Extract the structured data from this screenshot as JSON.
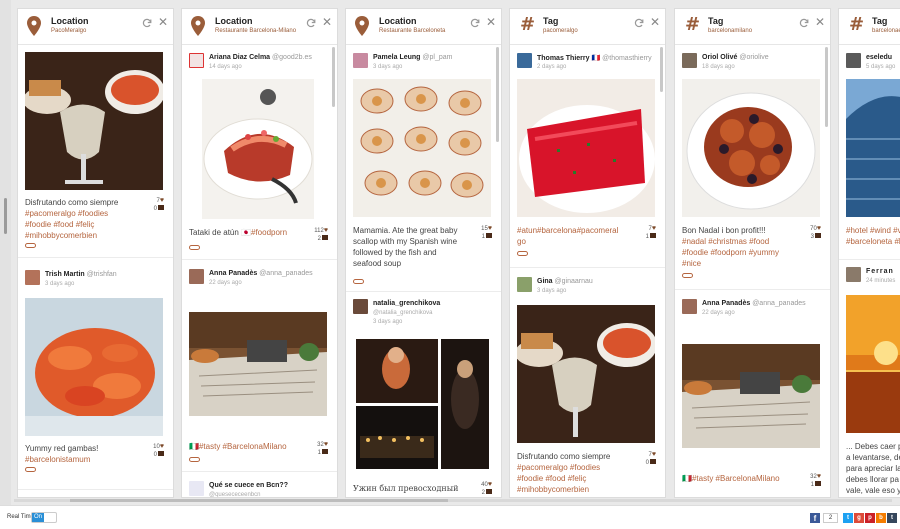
{
  "colors": {
    "accent": "#9a5d3a",
    "tag": "#b5653f",
    "toggle_on": "#2a8fd6"
  },
  "columns": [
    {
      "type_icon": "location-pin-icon",
      "title": "Location",
      "subtitle": "PacoMeralgo",
      "cards": [
        {
          "caption_text": "Disfrutando como siempre",
          "tags": [
            "#pacomeralgo #foodies",
            "#foodie #food #feliç",
            "#mihobbycomerbien"
          ],
          "likes": "7",
          "comments": "0"
        },
        {
          "user": "Trish Martin",
          "handle": "@trishfan",
          "time": "3 days ago",
          "caption_text": "Yummy red gambas!",
          "tags": [
            "#barcelonistamum"
          ],
          "likes": "10",
          "comments": "0"
        }
      ]
    },
    {
      "type_icon": "location-pin-icon",
      "title": "Location",
      "subtitle": "Restaurante Barcelona-Milano",
      "cards": [
        {
          "user": "Ariana Diaz Celma",
          "handle": "@good2b.es",
          "time": "14 days ago",
          "caption_text": "Tataki de atún 🇯🇵",
          "tags": [
            "#foodporn"
          ],
          "likes": "112",
          "comments": "2"
        },
        {
          "user": "Anna Panadès",
          "handle": "@anna_panades",
          "time": "22 days ago",
          "caption_text": "🇮🇹",
          "tags": [
            "#tasty #BarcelonaMilano"
          ],
          "likes": "32",
          "comments": "1"
        },
        {
          "user": "Qué se cuece en Bcn??",
          "handle": "@quesececeenbcn",
          "time": ""
        }
      ]
    },
    {
      "type_icon": "location-pin-icon",
      "title": "Location",
      "subtitle": "Restaurante Barceloneta",
      "cards": [
        {
          "user": "Pamela Leung",
          "handle": "@pl_pam",
          "time": "3 days ago",
          "caption_text": "Mamamia. Ate the great baby scallop with my Spanish wine followed by the fish and seafood soup",
          "tags": [],
          "likes": "15",
          "comments": "1"
        },
        {
          "user": "natalia_grenchikova",
          "handle": "@natalia_grenchikova",
          "time": "3 days ago",
          "caption_text": "Ужин был превосходный",
          "tags": [],
          "likes": "40",
          "comments": "2"
        }
      ]
    },
    {
      "type_icon": "hashtag-icon",
      "title": "Tag",
      "subtitle": "pacomeralgo",
      "cards": [
        {
          "user": "Thomas Thierry 🇫🇷",
          "handle": "@thomasthierry",
          "time": "2 days ago",
          "caption_text": "",
          "tags": [
            "#atun#barcelona#pacomeral",
            "go"
          ],
          "likes": "7",
          "comments": "1"
        },
        {
          "user": "Gina",
          "handle": "@ginaarnau",
          "time": "3 days ago",
          "caption_text": "Disfrutando como siempre",
          "tags": [
            "#pacomeralgo #foodies",
            "#foodie #food #feliç",
            "#mihobbycomerbien"
          ],
          "likes": "7",
          "comments": "0"
        }
      ]
    },
    {
      "type_icon": "hashtag-icon",
      "title": "Tag",
      "subtitle": "barcelonamilano",
      "cards": [
        {
          "user": "Oriol Olivé",
          "handle": "@oriolive",
          "time": "18 days ago",
          "caption_text": "Bon Nadal i bon profit!!!",
          "tags": [
            "#nadal #christmas #food",
            "#foodie #foodporn #yummy",
            "#nice"
          ],
          "likes": "70",
          "comments": "3"
        },
        {
          "user": "Anna Panadès",
          "handle": "@anna_panades",
          "time": "22 days ago",
          "caption_text": "🇮🇹",
          "tags": [
            "#tasty #BarcelonaMilano"
          ],
          "likes": "32",
          "comments": "1"
        }
      ]
    },
    {
      "type_icon": "hashtag-icon",
      "title": "Tag",
      "subtitle": "barcelonaeta",
      "cards": [
        {
          "user": "eseledu",
          "handle": "",
          "time": "5 days ago",
          "caption_text": "",
          "tags": [
            "#hotel #wind #vie",
            "#barceloneta #b"
          ],
          "likes": "",
          "comments": ""
        },
        {
          "user": "Ferran",
          "handle": "",
          "time": "24 minutes",
          "caption_text": "... Debes caer p a levantarse, de para apreciar la debes llorar pa vale, vale eso ya",
          "tags": [],
          "likes": "",
          "comments": ""
        }
      ]
    }
  ],
  "footer": {
    "realtime_label": "Real Time",
    "toggle_label": "On",
    "fb_count": "2",
    "share_icons": [
      "facebook-icon",
      "twitter-icon",
      "googleplus-icon",
      "pinterest-icon",
      "blogger-icon",
      "tumblr-icon"
    ]
  }
}
